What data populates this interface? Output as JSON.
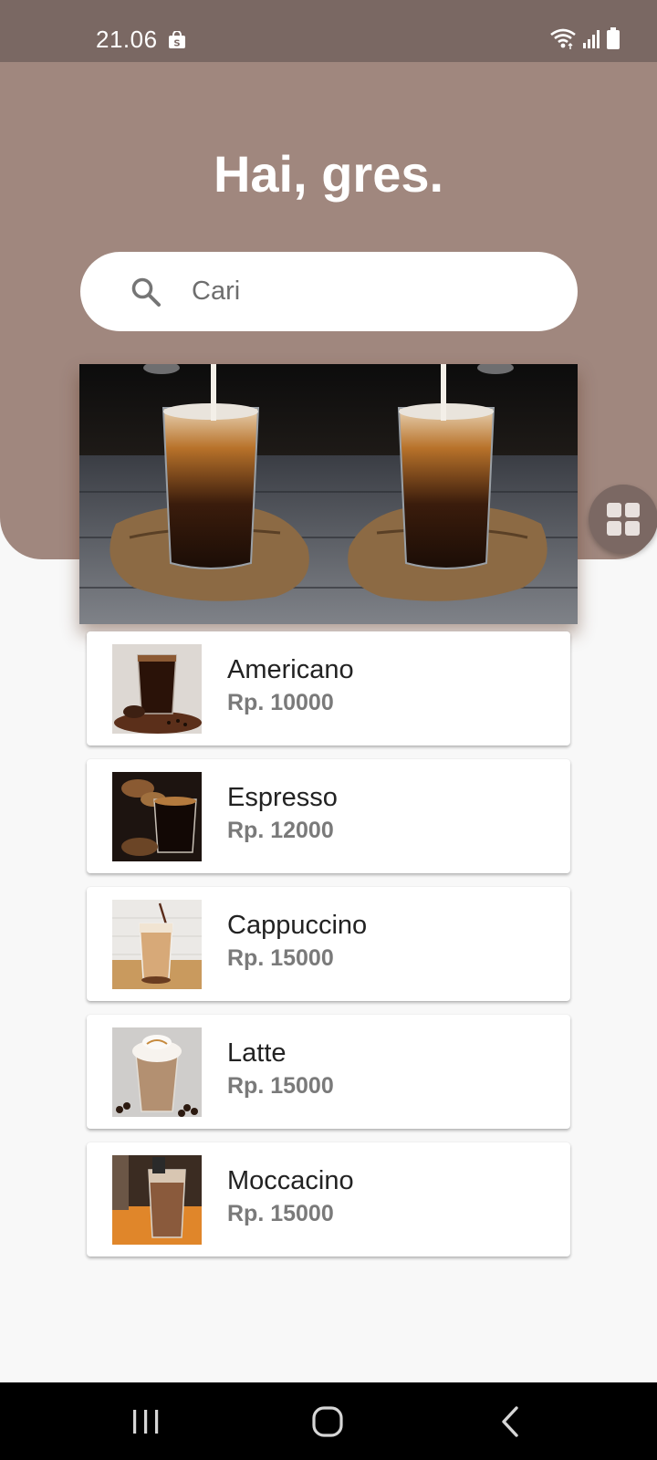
{
  "status_bar": {
    "time": "21.06",
    "icons": [
      "shopee-bag-icon",
      "wifi-icon",
      "signal-icon",
      "battery-icon"
    ]
  },
  "header": {
    "greeting": "Hai, gres.",
    "background_color": "#a0877e"
  },
  "search": {
    "placeholder": "Cari",
    "value": ""
  },
  "banner": {
    "subject": "iced coffee with milk"
  },
  "menu": {
    "items": [
      {
        "name": "Americano",
        "price": "Rp. 10000"
      },
      {
        "name": "Espresso",
        "price": "Rp. 12000"
      },
      {
        "name": "Cappuccino",
        "price": "Rp. 15000"
      },
      {
        "name": "Latte",
        "price": "Rp. 15000"
      },
      {
        "name": "Moccacino",
        "price": "Rp. 15000"
      }
    ]
  },
  "fab": {
    "icon": "grid-icon"
  },
  "nav": {
    "buttons": [
      "recent-apps-icon",
      "home-icon",
      "back-icon"
    ]
  },
  "colors": {
    "status_bar": "#7a6863",
    "header": "#a0877e",
    "fab": "#7b6863",
    "price_text": "#7a7a7a"
  }
}
